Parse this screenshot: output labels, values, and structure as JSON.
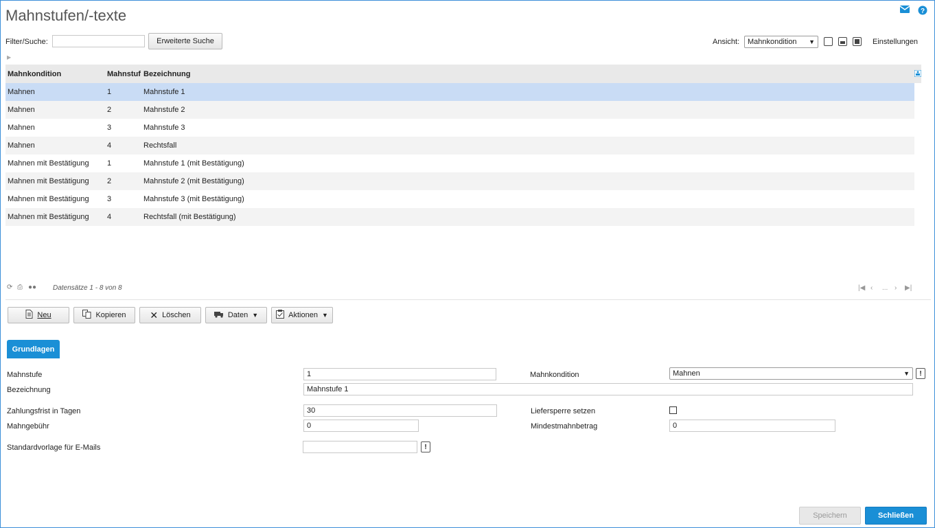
{
  "page": {
    "title": "Mahnstufen/-texte"
  },
  "colors": {
    "accent": "#1a8fd6",
    "selected_row": "#c9dcf5"
  },
  "top_icons": [
    "mail-icon",
    "help-icon"
  ],
  "toolbar": {
    "filter_label": "Filter/Suche:",
    "filter_value": "",
    "advanced_search_label": "Erweiterte Suche",
    "view_label": "Ansicht:",
    "view_value": "Mahnkondition",
    "settings_label": "Einstellungen"
  },
  "grid": {
    "columns": [
      "Mahnkondition",
      "Mahnstuf",
      "Bezeichnung"
    ],
    "rows": [
      [
        "Mahnen",
        "1",
        "Mahnstufe 1"
      ],
      [
        "Mahnen",
        "2",
        "Mahnstufe 2"
      ],
      [
        "Mahnen",
        "3",
        "Mahnstufe 3"
      ],
      [
        "Mahnen",
        "4",
        "Rechtsfall"
      ],
      [
        "Mahnen mit Bestätigung",
        "1",
        "Mahnstufe 1 (mit Bestätigung)"
      ],
      [
        "Mahnen mit Bestätigung",
        "2",
        "Mahnstufe 2 (mit Bestätigung)"
      ],
      [
        "Mahnen mit Bestätigung",
        "3",
        "Mahnstufe 3 (mit Bestätigung)"
      ],
      [
        "Mahnen mit Bestätigung",
        "4",
        "Rechtsfall (mit Bestätigung)"
      ]
    ],
    "selected_index": 0,
    "records_text": "Datensätze 1 - 8 von 8",
    "pager_ellipsis": "..."
  },
  "actions": {
    "new": "Neu",
    "copy": "Kopieren",
    "delete": "Löschen",
    "data": "Daten",
    "actions": "Aktionen"
  },
  "tabs": {
    "basics": "Grundlagen"
  },
  "form": {
    "mahnstufe_label": "Mahnstufe",
    "mahnstufe_value": "1",
    "mahnkondition_label": "Mahnkondition",
    "mahnkondition_value": "Mahnen",
    "bezeichnung_label": "Bezeichnung",
    "bezeichnung_value": "Mahnstufe 1",
    "zahlungsfrist_label": "Zahlungsfrist in Tagen",
    "zahlungsfrist_value": "30",
    "liefersperre_label": "Liefersperre setzen",
    "liefersperre_checked": false,
    "mahngebuehr_label": "Mahngebühr",
    "mahngebuehr_value": "0",
    "mindestmahnbetrag_label": "Mindestmahnbetrag",
    "mindestmahnbetrag_value": "0",
    "standardvorlage_label": "Standardvorlage für E-Mails",
    "standardvorlage_value": "",
    "exclamation": "!"
  },
  "footer": {
    "save": "Speichern",
    "close": "Schließen"
  }
}
